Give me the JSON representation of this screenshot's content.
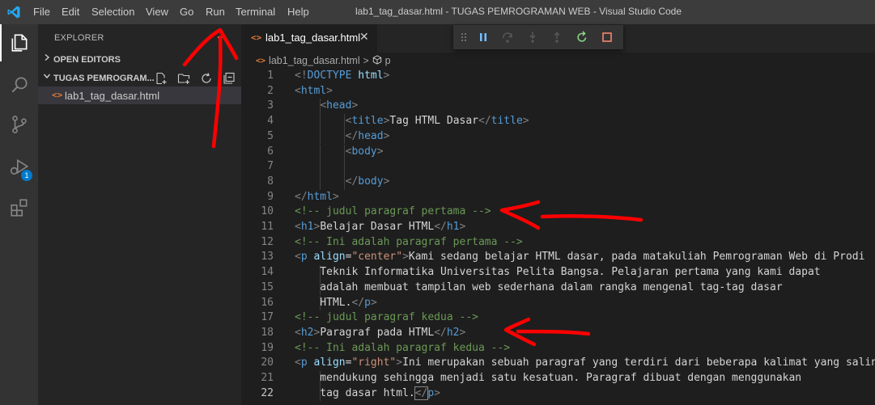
{
  "titlebar": {
    "menus": [
      "File",
      "Edit",
      "Selection",
      "View",
      "Go",
      "Run",
      "Terminal",
      "Help"
    ],
    "window_title": "lab1_tag_dasar.html - TUGAS PEMROGRAMAN WEB - Visual Studio Code"
  },
  "activity_bar": {
    "items": [
      "explorer-icon",
      "search-icon",
      "source-control-icon",
      "run-debug-icon",
      "extensions-icon"
    ],
    "debug_badge": "1"
  },
  "sidebar": {
    "title": "EXPLORER",
    "more": "...",
    "open_editors": "OPEN EDITORS",
    "workspace": "TUGAS PEMROGRAM...",
    "file_icon": "<>",
    "file_name": "lab1_tag_dasar.html"
  },
  "editor": {
    "tab_icon": "<>",
    "tab_label": "lab1_tag_dasar.html",
    "tab_close": "✕",
    "breadcrumb_icon": "<>",
    "breadcrumb_file": "lab1_tag_dasar.html",
    "breadcrumb_sep": ">",
    "breadcrumb_symbol": "p",
    "current_line": 22
  },
  "colors": {
    "accent": "#007acc",
    "annotation_red": "#ff0000",
    "debug_continue_blue": "#75beff",
    "debug_restart_green": "#89d185",
    "debug_stop_red": "#f48771"
  },
  "code_lines": [
    [
      [
        "tg",
        "<!"
      ],
      [
        "tn",
        "DOCTYPE"
      ],
      [
        "tx",
        " "
      ],
      [
        "an",
        "html"
      ],
      [
        "tg",
        ">"
      ]
    ],
    [
      [
        "tg",
        "<"
      ],
      [
        "tn",
        "html"
      ],
      [
        "tg",
        ">"
      ]
    ],
    [
      [
        "tx",
        "    "
      ],
      [
        "tg",
        "<"
      ],
      [
        "tn",
        "head"
      ],
      [
        "tg",
        ">"
      ]
    ],
    [
      [
        "tx",
        "        "
      ],
      [
        "tg",
        "<"
      ],
      [
        "tn",
        "title"
      ],
      [
        "tg",
        ">"
      ],
      [
        "tx",
        "Tag HTML Dasar"
      ],
      [
        "tg",
        "</"
      ],
      [
        "tn",
        "title"
      ],
      [
        "tg",
        ">"
      ]
    ],
    [
      [
        "tx",
        "        "
      ],
      [
        "tg",
        "</"
      ],
      [
        "tn",
        "head"
      ],
      [
        "tg",
        ">"
      ]
    ],
    [
      [
        "tx",
        "        "
      ],
      [
        "tg",
        "<"
      ],
      [
        "tn",
        "body"
      ],
      [
        "tg",
        ">"
      ]
    ],
    [
      [
        "tx",
        ""
      ]
    ],
    [
      [
        "tx",
        "        "
      ],
      [
        "tg",
        "</"
      ],
      [
        "tn",
        "body"
      ],
      [
        "tg",
        ">"
      ]
    ],
    [
      [
        "tg",
        "</"
      ],
      [
        "tn",
        "html"
      ],
      [
        "tg",
        ">"
      ]
    ],
    [
      [
        "cm",
        "<!-- judul paragraf pertama -->"
      ]
    ],
    [
      [
        "tg",
        "<"
      ],
      [
        "tn",
        "h1"
      ],
      [
        "tg",
        ">"
      ],
      [
        "tx",
        "Belajar Dasar HTML"
      ],
      [
        "tg",
        "</"
      ],
      [
        "tn",
        "h1"
      ],
      [
        "tg",
        ">"
      ]
    ],
    [
      [
        "cm",
        "<!-- Ini adalah paragraf pertama -->"
      ]
    ],
    [
      [
        "tg",
        "<"
      ],
      [
        "tn",
        "p"
      ],
      [
        "tx",
        " "
      ],
      [
        "an",
        "align"
      ],
      [
        "tx",
        "="
      ],
      [
        "av",
        "\"center\""
      ],
      [
        "tg",
        ">"
      ],
      [
        "tx",
        "Kami sedang belajar HTML dasar, pada matakuliah Pemrograman Web di Prodi"
      ]
    ],
    [
      [
        "tx",
        "    Teknik Informatika Universitas Pelita Bangsa. Pelajaran pertama yang kami dapat"
      ]
    ],
    [
      [
        "tx",
        "    adalah membuat tampilan web sederhana dalam rangka mengenal tag-tag dasar"
      ]
    ],
    [
      [
        "tx",
        "    HTML."
      ],
      [
        "tg",
        "</"
      ],
      [
        "tn",
        "p"
      ],
      [
        "tg",
        ">"
      ]
    ],
    [
      [
        "cm",
        "<!-- judul paragraf kedua -->"
      ]
    ],
    [
      [
        "tg",
        "<"
      ],
      [
        "tn",
        "h2"
      ],
      [
        "tg",
        ">"
      ],
      [
        "tx",
        "Paragraf pada HTML"
      ],
      [
        "tg",
        "</"
      ],
      [
        "tn",
        "h2"
      ],
      [
        "tg",
        ">"
      ]
    ],
    [
      [
        "cm",
        "<!-- Ini adalah paragraf kedua -->"
      ]
    ],
    [
      [
        "tg",
        "<"
      ],
      [
        "tn",
        "p"
      ],
      [
        "tx",
        " "
      ],
      [
        "an",
        "align"
      ],
      [
        "tx",
        "="
      ],
      [
        "av",
        "\"right\""
      ],
      [
        "tg",
        ">"
      ],
      [
        "tx",
        "Ini merupakan sebuah paragraf yang terdiri dari beberapa kalimat yang saling"
      ]
    ],
    [
      [
        "tx",
        "    mendukung sehingga menjadi satu kesatuan. Paragraf dibuat dengan menggunakan"
      ]
    ],
    [
      [
        "tx",
        "    tag dasar html."
      ],
      [
        "tg",
        "</"
      ],
      [
        "tn",
        "p"
      ],
      [
        "tg",
        ">"
      ]
    ]
  ]
}
